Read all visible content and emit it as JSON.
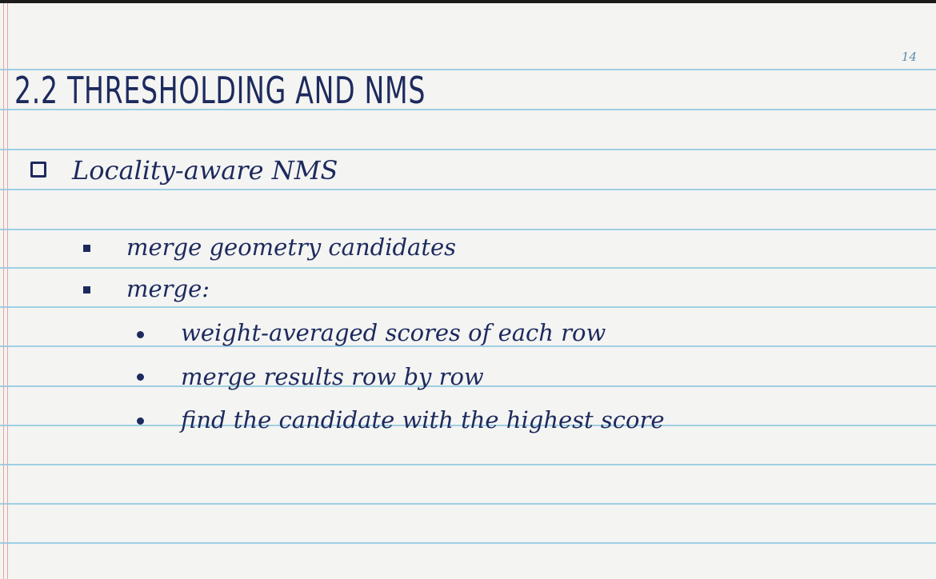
{
  "page_number": "14",
  "title": "2.2 THRESHOLDING AND NMS",
  "main_bullet": "Locality-aware NMS",
  "level2_bullets": [
    "merge geometry candidates",
    "merge:"
  ],
  "level3_bullets": [
    "weight-averaged scores of each row",
    "merge results row by row",
    "find the candidate with the highest score"
  ],
  "colors": {
    "ink": "#1d2a5e",
    "rule_line": "#8fc8e0",
    "margin_line": "#e7a3a0",
    "paper": "#f4f4f2"
  }
}
